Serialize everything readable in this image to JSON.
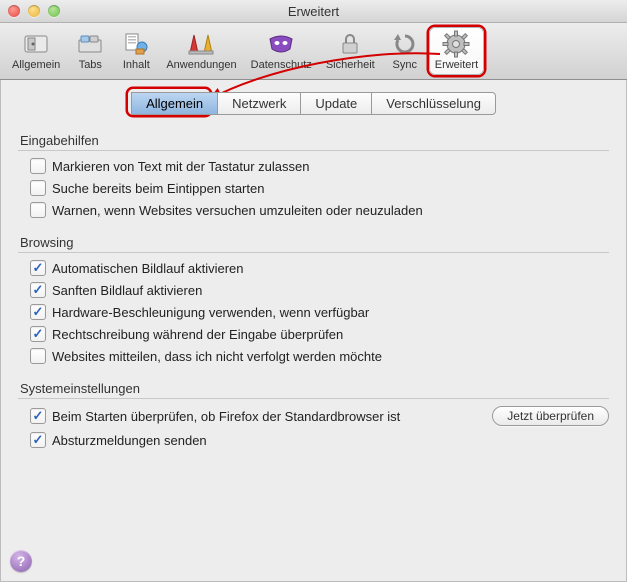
{
  "window": {
    "title": "Erweitert"
  },
  "toolbar": {
    "items": [
      {
        "label": "Allgemein"
      },
      {
        "label": "Tabs"
      },
      {
        "label": "Inhalt"
      },
      {
        "label": "Anwendungen"
      },
      {
        "label": "Datenschutz"
      },
      {
        "label": "Sicherheit"
      },
      {
        "label": "Sync"
      },
      {
        "label": "Erweitert"
      }
    ]
  },
  "tabs": {
    "items": [
      {
        "label": "Allgemein"
      },
      {
        "label": "Netzwerk"
      },
      {
        "label": "Update"
      },
      {
        "label": "Verschlüsselung"
      }
    ]
  },
  "sections": {
    "accessibility": {
      "title": "Eingabehilfen",
      "items": [
        {
          "label": "Markieren von Text mit der Tastatur zulassen",
          "checked": false
        },
        {
          "label": "Suche bereits beim Eintippen starten",
          "checked": false
        },
        {
          "label": "Warnen, wenn Websites versuchen umzuleiten oder neuzuladen",
          "checked": false
        }
      ]
    },
    "browsing": {
      "title": "Browsing",
      "items": [
        {
          "label": "Automatischen Bildlauf aktivieren",
          "checked": true
        },
        {
          "label": "Sanften Bildlauf aktivieren",
          "checked": true
        },
        {
          "label": "Hardware-Beschleunigung verwenden, wenn verfügbar",
          "checked": true
        },
        {
          "label": "Rechtschreibung während der Eingabe überprüfen",
          "checked": true
        },
        {
          "label": "Websites mitteilen, dass ich nicht verfolgt werden möchte",
          "checked": false
        }
      ]
    },
    "system": {
      "title": "Systemeinstellungen",
      "items": [
        {
          "label": "Beim Starten überprüfen, ob Firefox der Standardbrowser ist",
          "checked": true,
          "button": "Jetzt überprüfen"
        },
        {
          "label": "Absturzmeldungen senden",
          "checked": true
        }
      ]
    }
  },
  "help_glyph": "?"
}
